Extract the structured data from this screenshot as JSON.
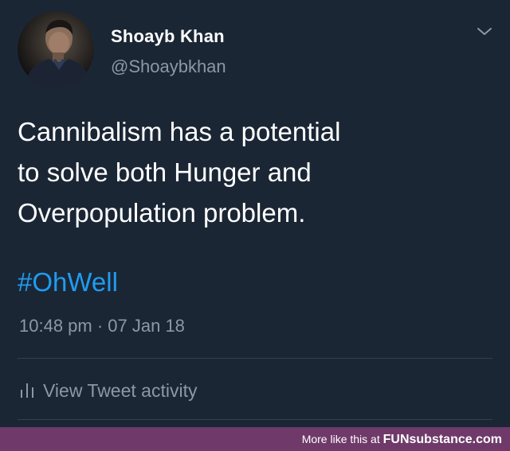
{
  "author": {
    "display_name": "Shoayb Khan",
    "handle": "@Shoaybkhan"
  },
  "tweet": {
    "lines": [
      "Cannibalism has a potential",
      "to solve both Hunger and",
      "Overpopulation problem."
    ],
    "hashtag": "#OhWell",
    "timestamp": "10:48 pm · 07 Jan 18"
  },
  "actions": {
    "view_activity_label": "View Tweet activity"
  },
  "footer": {
    "prefix": "More like this at ",
    "brand": "FUNsubstance.com"
  },
  "colors": {
    "background": "#1b2635",
    "hashtag": "#1f9cf0",
    "muted": "#8b98a6",
    "footer_bar": "#6f3a69"
  },
  "icons": {
    "menu": "chevron-down-icon",
    "activity": "bar-chart-icon"
  }
}
